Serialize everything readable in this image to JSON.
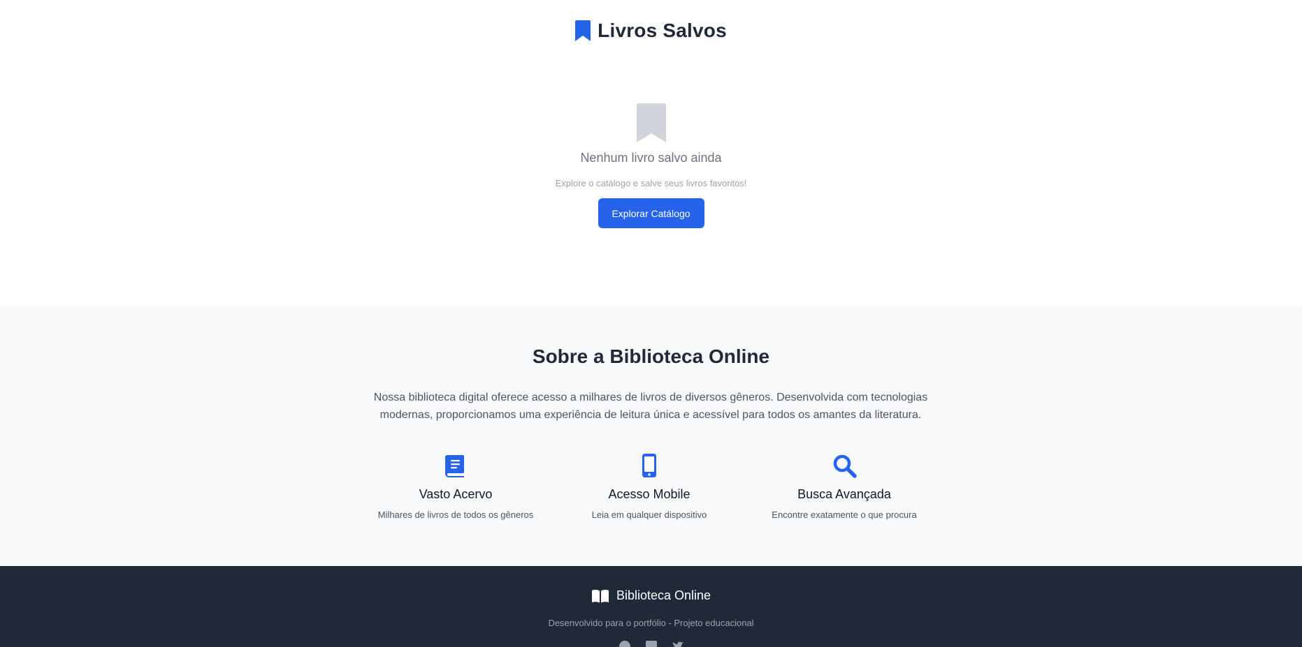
{
  "saved": {
    "title": "Livros Salvos",
    "title_icon": "bookmark-icon",
    "empty": {
      "icon": "bookmark-icon",
      "title": "Nenhum livro salvo ainda",
      "subtitle": "Explore o catálogo e salve seus livros favoritos!",
      "button_label": "Explorar Catálogo"
    }
  },
  "about": {
    "title": "Sobre a Biblioteca Online",
    "text": "Nossa biblioteca digital oferece acesso a milhares de livros de diversos gêneros. Desenvolvida com tecnologias modernas, proporcionamos uma experiência de leitura única e acessível para todos os amantes da literatura.",
    "features": [
      {
        "icon": "book-icon",
        "title": "Vasto Acervo",
        "desc": "Milhares de livros de todos os gêneros"
      },
      {
        "icon": "mobile-icon",
        "title": "Acesso Mobile",
        "desc": "Leia em qualquer dispositivo"
      },
      {
        "icon": "search-icon",
        "title": "Busca Avançada",
        "desc": "Encontre exatamente o que procura"
      }
    ]
  },
  "footer": {
    "brand": "Biblioteca Online",
    "brand_icon": "book-open-icon",
    "credit": "Desenvolvido para o portfólio - Projeto educacional",
    "social_icons": [
      "github-icon",
      "linkedin-icon",
      "twitter-icon"
    ]
  },
  "colors": {
    "accent": "#2563eb",
    "text_dark": "#1f2937",
    "muted": "#6b7280",
    "about_bg": "#f8f9fb",
    "footer_bg": "#1f2937"
  }
}
